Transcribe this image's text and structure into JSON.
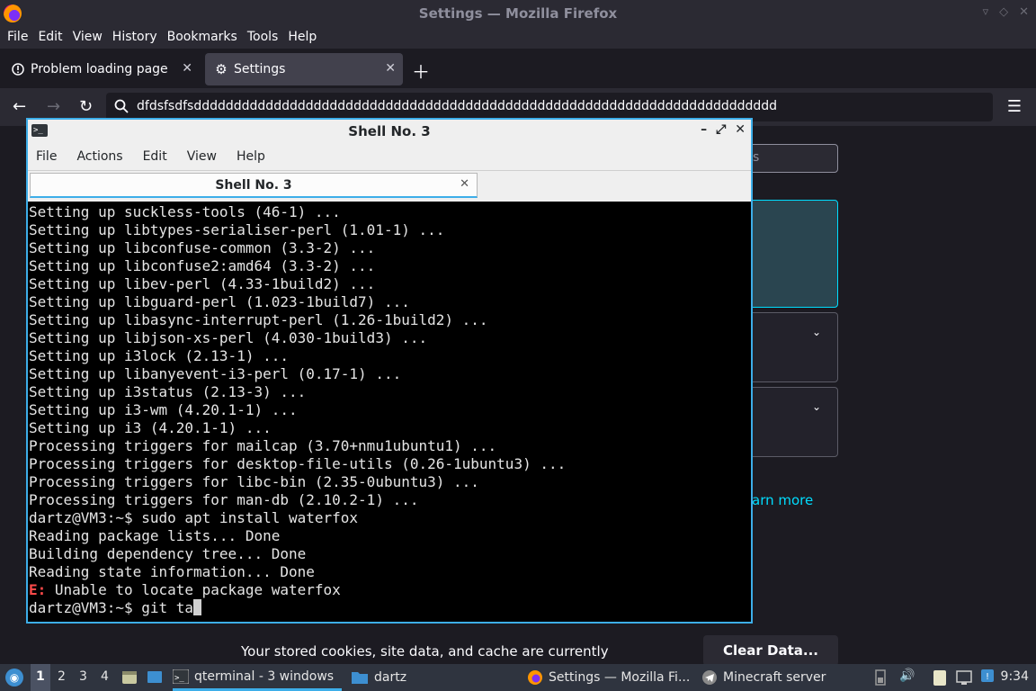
{
  "firefox": {
    "window_title": "Settings — Mozilla Firefox",
    "menu": [
      "File",
      "Edit",
      "View",
      "History",
      "Bookmarks",
      "Tools",
      "Help"
    ],
    "tabs": [
      {
        "label": "Problem loading page",
        "active": false
      },
      {
        "label": "Settings",
        "active": true
      }
    ],
    "url": "dfdsfsdfsddddddddddddddddddddddddddddddddddddddddddddddddddddddddddddddddddddddddd",
    "settings": {
      "search_placeholder_fragment": "s",
      "learn_more_fragment": "arn more",
      "cookie_text": "Your stored cookies, site data, and cache are currently",
      "clear_data_label": "Clear Data..."
    }
  },
  "terminal": {
    "window_title": "Shell No. 3",
    "menu": [
      "File",
      "Actions",
      "Edit",
      "View",
      "Help"
    ],
    "tab_label": "Shell No. 3",
    "lines": [
      "Setting up suckless-tools (46-1) ...",
      "Setting up libtypes-serialiser-perl (1.01-1) ...",
      "Setting up libconfuse-common (3.3-2) ...",
      "Setting up libconfuse2:amd64 (3.3-2) ...",
      "Setting up libev-perl (4.33-1build2) ...",
      "Setting up libguard-perl (1.023-1build7) ...",
      "Setting up libasync-interrupt-perl (1.26-1build2) ...",
      "Setting up libjson-xs-perl (4.030-1build3) ...",
      "Setting up i3lock (2.13-1) ...",
      "Setting up libanyevent-i3-perl (0.17-1) ...",
      "Setting up i3status (2.13-3) ...",
      "Setting up i3-wm (4.20.1-1) ...",
      "Setting up i3 (4.20.1-1) ...",
      "Processing triggers for mailcap (3.70+nmu1ubuntu1) ...",
      "Processing triggers for desktop-file-utils (0.26-1ubuntu3) ...",
      "Processing triggers for libc-bin (2.35-0ubuntu3) ...",
      "Processing triggers for man-db (2.10.2-1) ...",
      "dartz@VM3:~$ sudo apt install waterfox",
      "Reading package lists... Done",
      "Building dependency tree... Done",
      "Reading state information... Done"
    ],
    "error_prefix": "E:",
    "error_message": " Unable to locate package waterfox",
    "prompt_line": "dartz@VM3:~$ git ta"
  },
  "taskbar": {
    "workspaces": [
      "1",
      "2",
      "3",
      "4"
    ],
    "active_workspace": "1",
    "tasks": [
      {
        "label": "qterminal - 3 windows",
        "icon": "terminal-icon",
        "active": true
      },
      {
        "label": "dartz",
        "icon": "folder-icon",
        "active": false
      },
      {
        "label": "Settings — Mozilla Fi...",
        "icon": "firefox-icon",
        "active": false
      },
      {
        "label": "Minecraft server",
        "icon": "telegram-icon",
        "active": false
      }
    ],
    "clock": "9:34"
  },
  "colors": {
    "accent": "#3daee9",
    "firefox_link": "#00ddff",
    "terminal_bg": "#000000",
    "error_red": "#ff4a4a"
  }
}
